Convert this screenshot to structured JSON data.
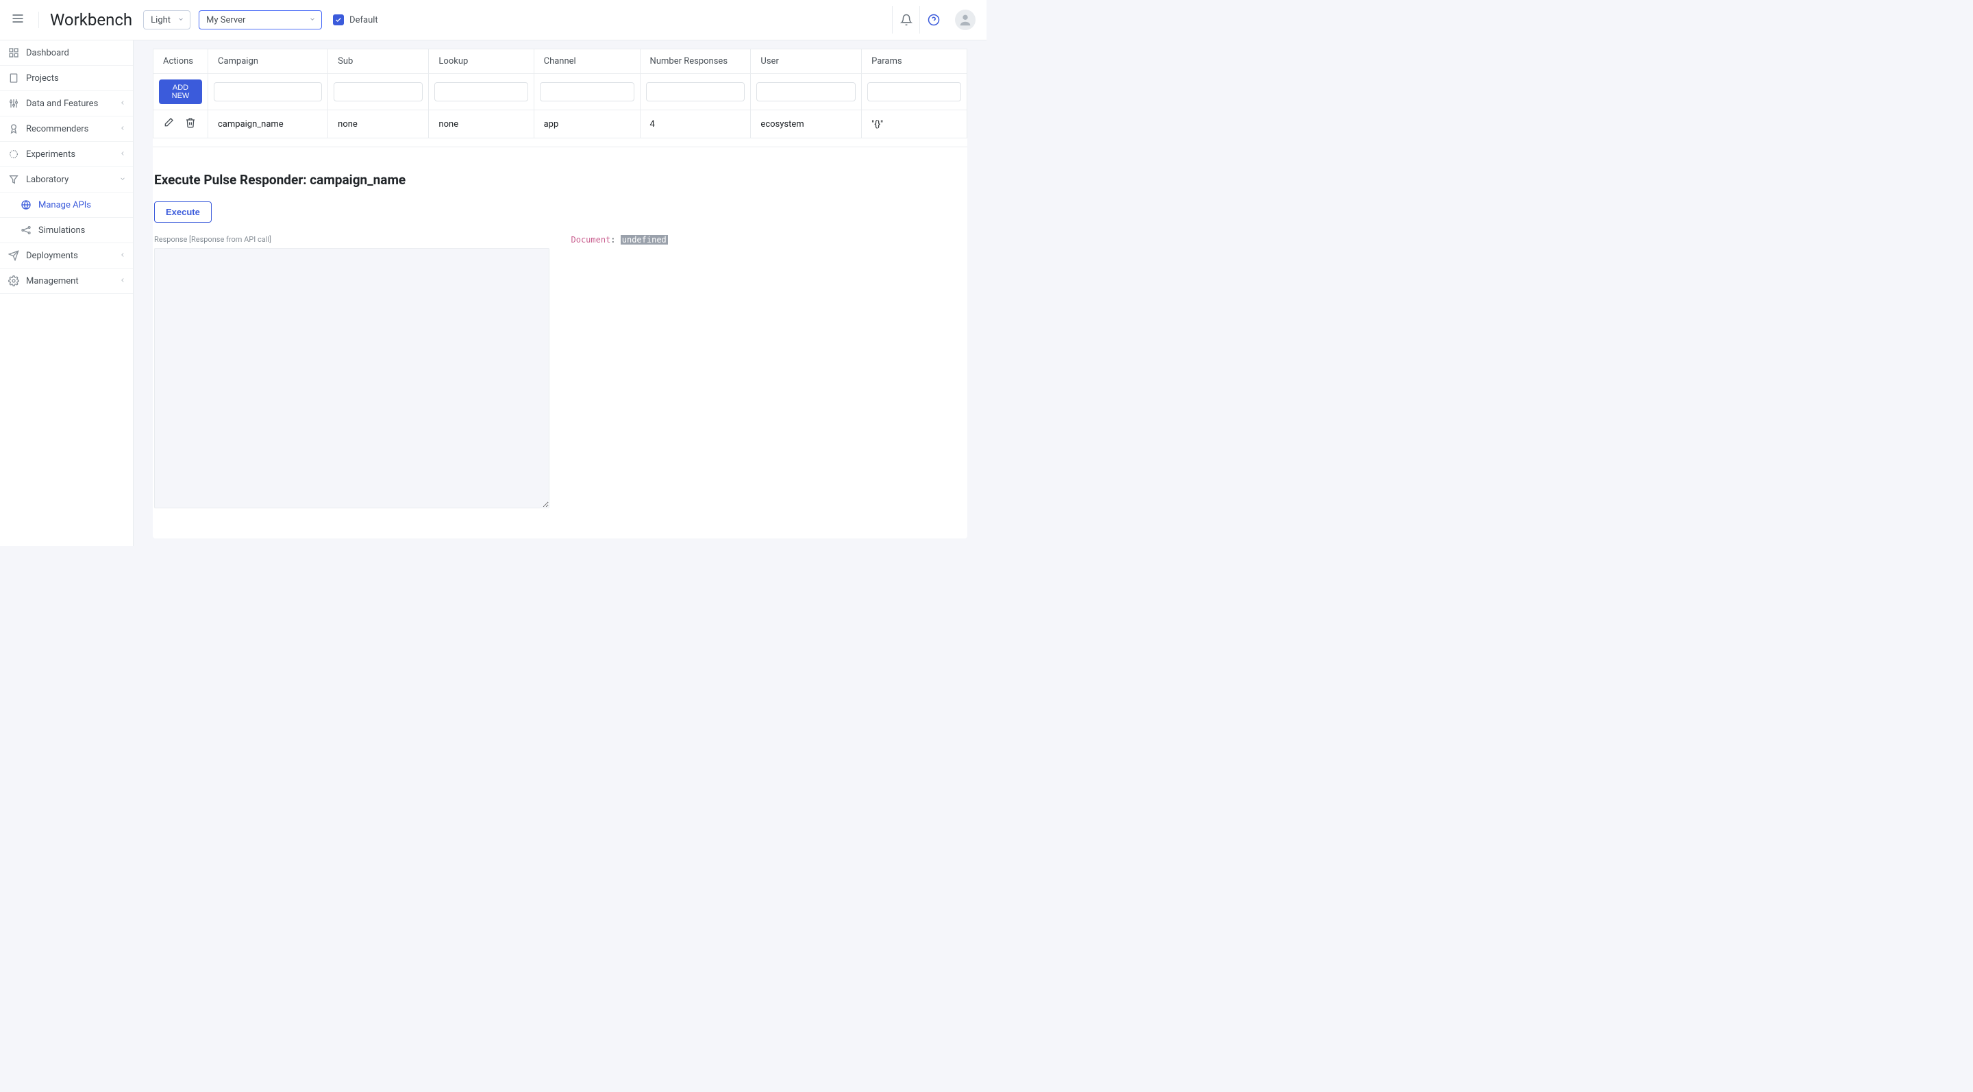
{
  "header": {
    "brand": "Workbench",
    "theme_select": "Light",
    "server_select": "My Server",
    "default_checkbox_label": "Default"
  },
  "sidebar": {
    "items": [
      {
        "label": "Dashboard",
        "icon": "grid",
        "expandable": false
      },
      {
        "label": "Projects",
        "icon": "file",
        "expandable": false
      },
      {
        "label": "Data and Features",
        "icon": "sliders",
        "expandable": true
      },
      {
        "label": "Recommenders",
        "icon": "badge",
        "expandable": true
      },
      {
        "label": "Experiments",
        "icon": "spark",
        "expandable": true
      },
      {
        "label": "Laboratory",
        "icon": "funnel",
        "expandable": true,
        "expanded": true,
        "children": [
          {
            "label": "Manage APIs",
            "icon": "globe",
            "active": true
          },
          {
            "label": "Simulations",
            "icon": "network"
          }
        ]
      },
      {
        "label": "Deployments",
        "icon": "send",
        "expandable": true
      },
      {
        "label": "Management",
        "icon": "gear",
        "expandable": true
      }
    ]
  },
  "table": {
    "headers": [
      "Actions",
      "Campaign",
      "Sub",
      "Lookup",
      "Channel",
      "Number Responses",
      "User",
      "Params"
    ],
    "add_new_label": "ADD NEW",
    "row": {
      "campaign": "campaign_name",
      "sub": "none",
      "lookup": "none",
      "channel": "app",
      "number_responses": "4",
      "user": "ecosystem",
      "params": "\"{}\""
    }
  },
  "section": {
    "title": "Execute Pulse Responder: campaign_name",
    "execute_label": "Execute",
    "response_label": "Response [Response from API call]",
    "document_key": "Document",
    "document_value": "undefined"
  }
}
